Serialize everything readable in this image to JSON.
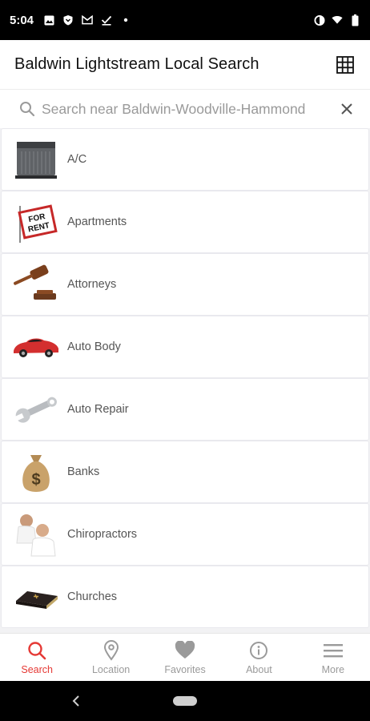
{
  "status_bar": {
    "time": "5:04",
    "left_icons": [
      "image-icon",
      "shield-icon",
      "mail-icon",
      "check-download-icon",
      "dot-icon"
    ],
    "right_icons": [
      "data-saver-icon",
      "wifi-icon",
      "battery-icon"
    ]
  },
  "app_bar": {
    "title": "Baldwin Lightstream Local Search",
    "grid_icon": "grid-icon"
  },
  "search": {
    "placeholder": "Search near Baldwin-Woodville-Hammond"
  },
  "categories": [
    {
      "label": "A/C",
      "icon": "ac-unit-icon"
    },
    {
      "label": "Apartments",
      "icon": "for-rent-sign-icon"
    },
    {
      "label": "Attorneys",
      "icon": "gavel-icon"
    },
    {
      "label": "Auto Body",
      "icon": "red-car-icon"
    },
    {
      "label": "Auto Repair",
      "icon": "wrench-icon"
    },
    {
      "label": "Banks",
      "icon": "money-bag-icon"
    },
    {
      "label": "Chiropractors",
      "icon": "chiropractor-icon"
    },
    {
      "label": "Churches",
      "icon": "bible-icon"
    }
  ],
  "bottom_nav": [
    {
      "label": "Search",
      "icon": "search-icon",
      "active": true
    },
    {
      "label": "Location",
      "icon": "location-pin-icon",
      "active": false
    },
    {
      "label": "Favorites",
      "icon": "heart-icon",
      "active": false
    },
    {
      "label": "About",
      "icon": "info-icon",
      "active": false
    },
    {
      "label": "More",
      "icon": "menu-icon",
      "active": false
    }
  ],
  "colors": {
    "accent": "#e53935",
    "inactive": "#9a9a9a",
    "status_bar": "#000000"
  }
}
